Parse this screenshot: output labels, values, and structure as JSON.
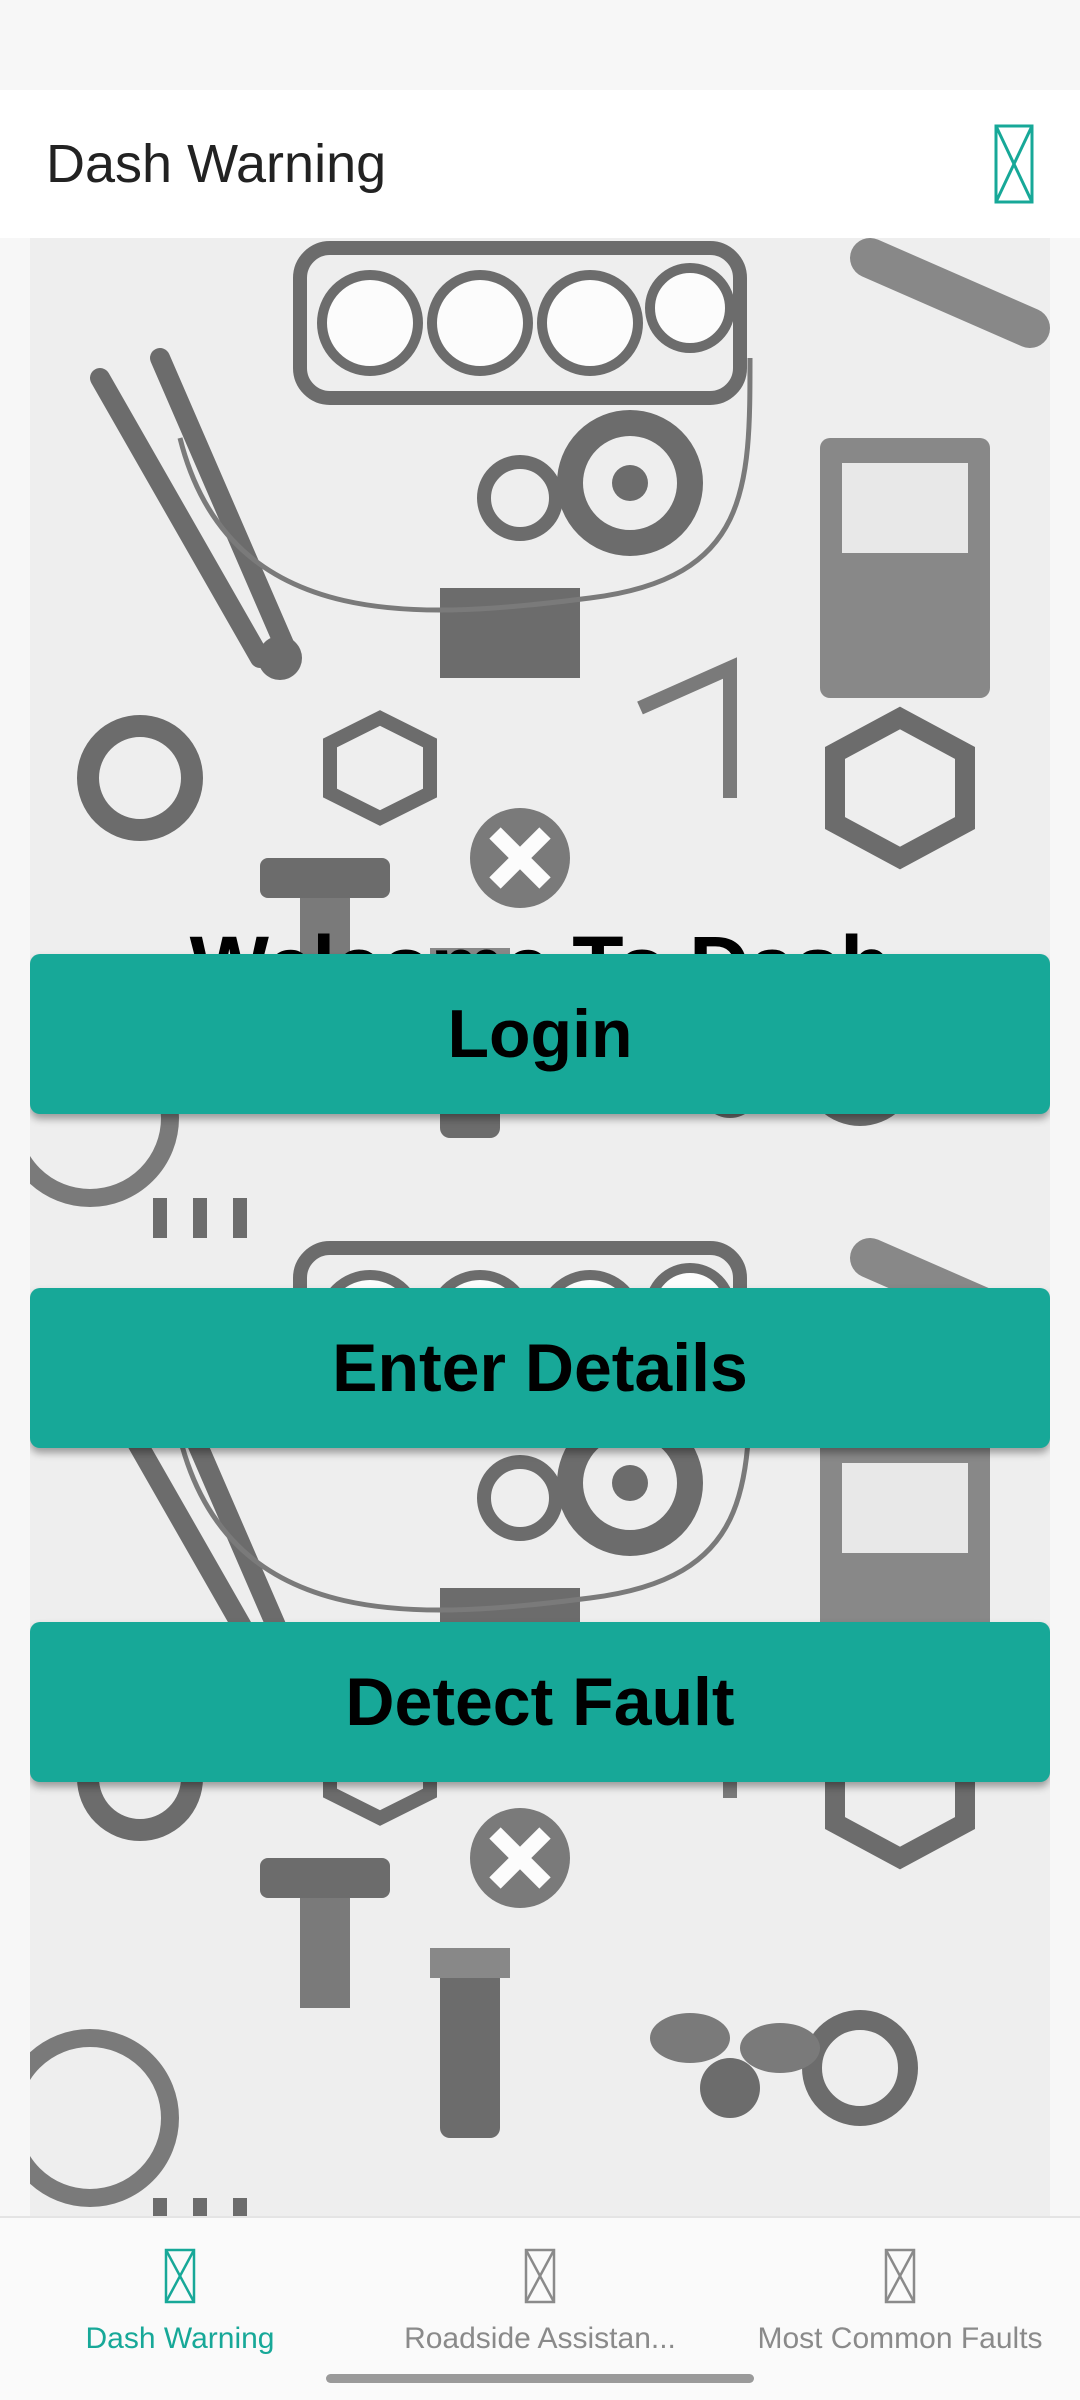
{
  "app_bar": {
    "title": "Dash Warning",
    "action_icon": "broken-image-icon"
  },
  "main": {
    "welcome_text": "Welcome To Dash Warning",
    "buttons": {
      "login": "Login",
      "enter_details": "Enter Details",
      "detect_fault": "Detect Fault"
    },
    "background": "tools-pattern-image"
  },
  "bottom_nav": {
    "items": [
      {
        "label": "Dash Warning",
        "icon": "broken-image-icon",
        "active": true
      },
      {
        "label": "Roadside Assistan...",
        "icon": "broken-image-icon",
        "active": false
      },
      {
        "label": "Most Common Faults",
        "icon": "broken-image-icon",
        "active": false
      }
    ]
  },
  "colors": {
    "accent": "#17a898",
    "inactive": "#8a8a8a",
    "text": "#000000"
  }
}
